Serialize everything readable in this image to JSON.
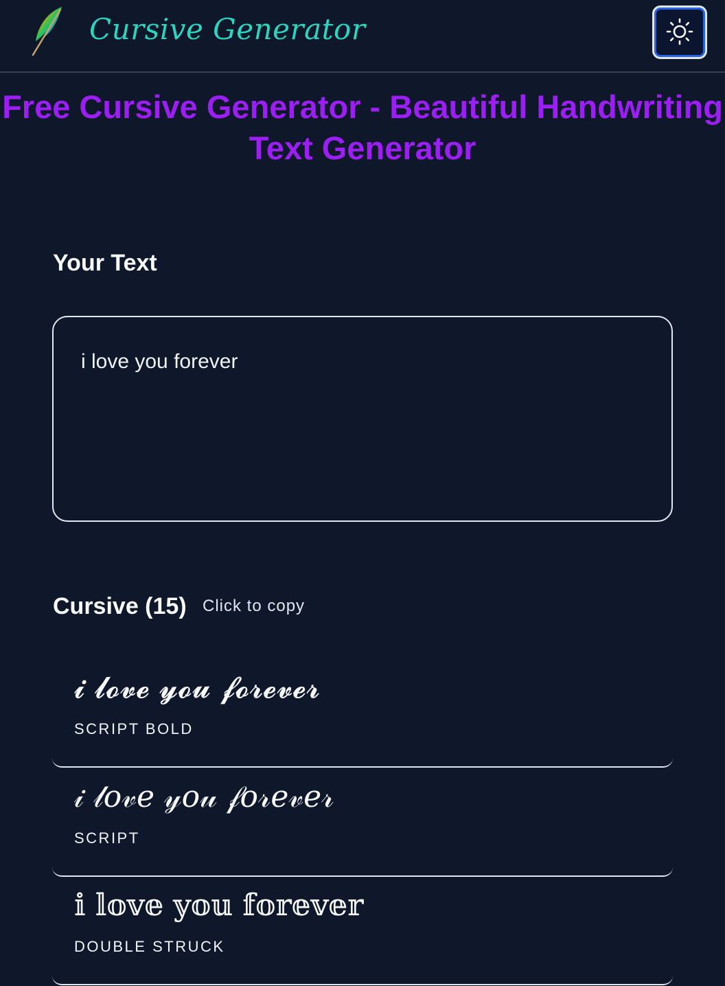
{
  "header": {
    "logo_icon": "feather-quill-icon",
    "logo_text": "Cursive Generator",
    "theme_toggle_icon": "sun-icon"
  },
  "page_title": "Free Cursive Generator - Beautiful Handwriting Text Generator",
  "input_section": {
    "label": "Your Text",
    "value": "i love you forever"
  },
  "results": {
    "heading": "Cursive (15)",
    "hint": "Click to copy",
    "items": [
      {
        "text": "𝓲 𝓵𝓸𝓿𝓮 𝔂𝓸𝓾 𝓯𝓸𝓻𝓮𝓿𝓮𝓻",
        "label": "SCRIPT BOLD"
      },
      {
        "text": "𝒾 𝓁𝑜𝓋𝑒 𝓎𝑜𝓊 𝒻𝑜𝓇𝑒𝓋𝑒𝓇",
        "label": "SCRIPT"
      },
      {
        "text": "𝕚 𝕝𝕠𝕧𝕖 𝕪𝕠𝕦 𝕗𝕠𝕣𝕖𝕧𝕖𝕣",
        "label": "DOUBLE STRUCK"
      }
    ]
  }
}
